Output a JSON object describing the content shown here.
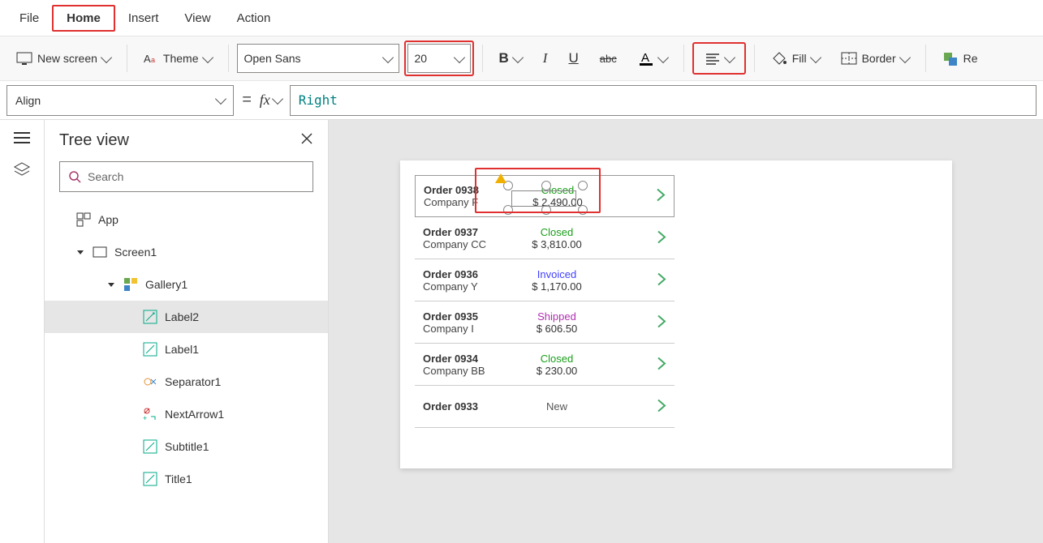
{
  "menu": {
    "file": "File",
    "home": "Home",
    "insert": "Insert",
    "view": "View",
    "action": "Action"
  },
  "ribbon": {
    "new_screen": "New screen",
    "theme": "Theme",
    "font": "Open Sans",
    "font_size": "20",
    "fill": "Fill",
    "border": "Border",
    "reorder": "Re"
  },
  "formula": {
    "property": "Align",
    "value": "Right"
  },
  "tree": {
    "title": "Tree view",
    "search_placeholder": "Search",
    "items": {
      "app": "App",
      "screen": "Screen1",
      "gallery": "Gallery1",
      "label2": "Label2",
      "label1": "Label1",
      "separator": "Separator1",
      "nextarrow": "NextArrow1",
      "subtitle": "Subtitle1",
      "title_item": "Title1"
    }
  },
  "gallery": [
    {
      "order": "Order 0938",
      "company": "Company F",
      "status": "Closed",
      "status_cls": "closed",
      "price": "$ 2,490.00",
      "selected": true
    },
    {
      "order": "Order 0937",
      "company": "Company CC",
      "status": "Closed",
      "status_cls": "closed",
      "price": "$ 3,810.00"
    },
    {
      "order": "Order 0936",
      "company": "Company Y",
      "status": "Invoiced",
      "status_cls": "invoiced",
      "price": "$ 1,170.00"
    },
    {
      "order": "Order 0935",
      "company": "Company I",
      "status": "Shipped",
      "status_cls": "shipped",
      "price": "$ 606.50"
    },
    {
      "order": "Order 0934",
      "company": "Company BB",
      "status": "Closed",
      "status_cls": "closed",
      "price": "$ 230.00"
    },
    {
      "order": "Order 0933",
      "company": "",
      "status": "New",
      "status_cls": "new",
      "price": ""
    }
  ]
}
